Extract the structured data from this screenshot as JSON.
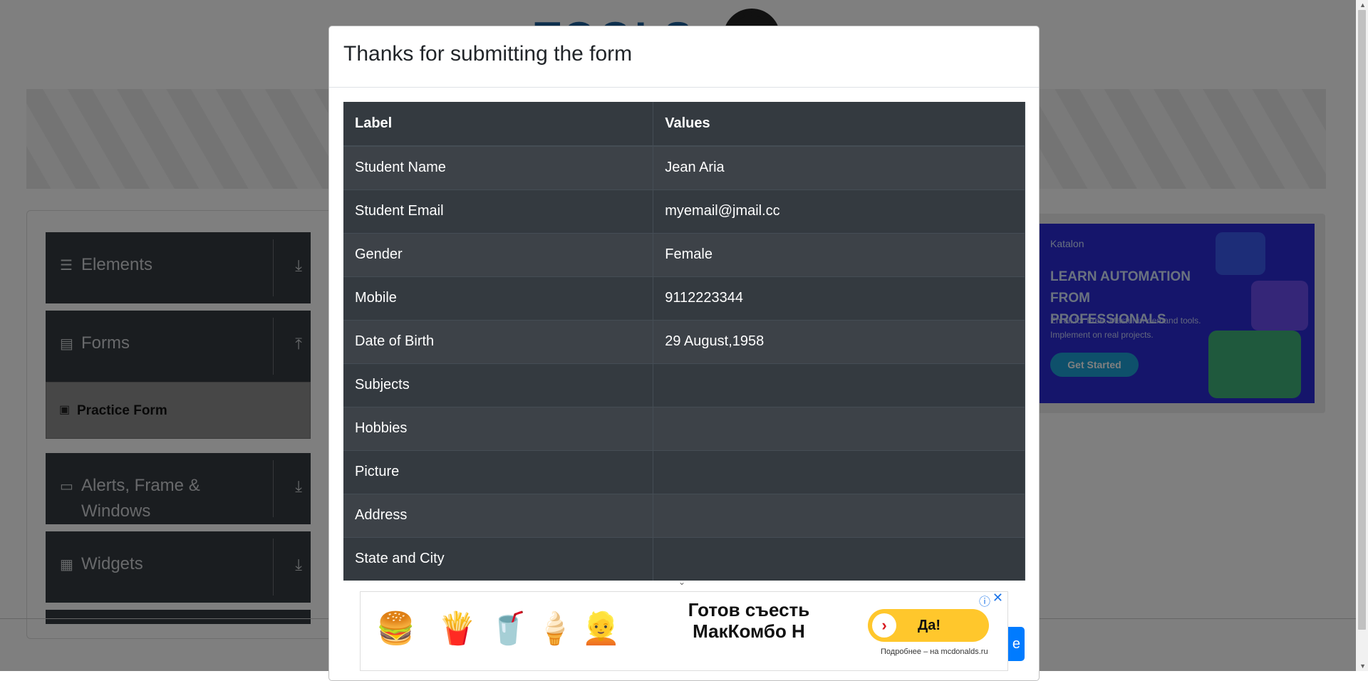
{
  "site": {
    "logo_text": "TOOLS",
    "sidebar": {
      "groups": [
        {
          "icon": "list-icon",
          "title": "Elements",
          "arrow": "⤓"
        },
        {
          "icon": "form-icon",
          "title": "Forms",
          "arrow": "⤒"
        },
        {
          "icon": "window-icon",
          "title": "Alerts, Frame & Windows",
          "arrow": "⤓"
        },
        {
          "icon": "widgets-icon",
          "title": "Widgets",
          "arrow": "⤓"
        }
      ],
      "active_item": "Practice Form"
    },
    "side_ad": {
      "brand": "Katalon",
      "headline": "LEARN AUTOMATION FROM PROFESSIONALS",
      "subtext": "Enroll for Free. Master in-demand tools. Implement on real projects.",
      "cta": "Get Started"
    }
  },
  "modal": {
    "title": "Thanks for submitting the form",
    "table": {
      "headers": [
        "Label",
        "Values"
      ],
      "rows": [
        {
          "label": "Student Name",
          "value": "Jean Aria"
        },
        {
          "label": "Student Email",
          "value": "myemail@jmail.cc"
        },
        {
          "label": "Gender",
          "value": "Female"
        },
        {
          "label": "Mobile",
          "value": "9112223344"
        },
        {
          "label": "Date of Birth",
          "value": "29 August,1958"
        },
        {
          "label": "Subjects",
          "value": ""
        },
        {
          "label": "Hobbies",
          "value": ""
        },
        {
          "label": "Picture",
          "value": ""
        },
        {
          "label": "Address",
          "value": ""
        },
        {
          "label": "State and City",
          "value": ""
        }
      ]
    },
    "close_label": "e"
  },
  "bottom_ad": {
    "headline": "Готов съесть МакКомбо Н",
    "button": "Да!",
    "small": "Подробнее – на mcdonalds.ru",
    "info": "ⓘ",
    "close": "✕"
  },
  "colors": {
    "table_dark": "#343a40",
    "table_stripe": "#3d4248",
    "primary": "#007bff",
    "ad_blue": "#2b2ad6",
    "mc_yellow": "#ffc72c"
  }
}
